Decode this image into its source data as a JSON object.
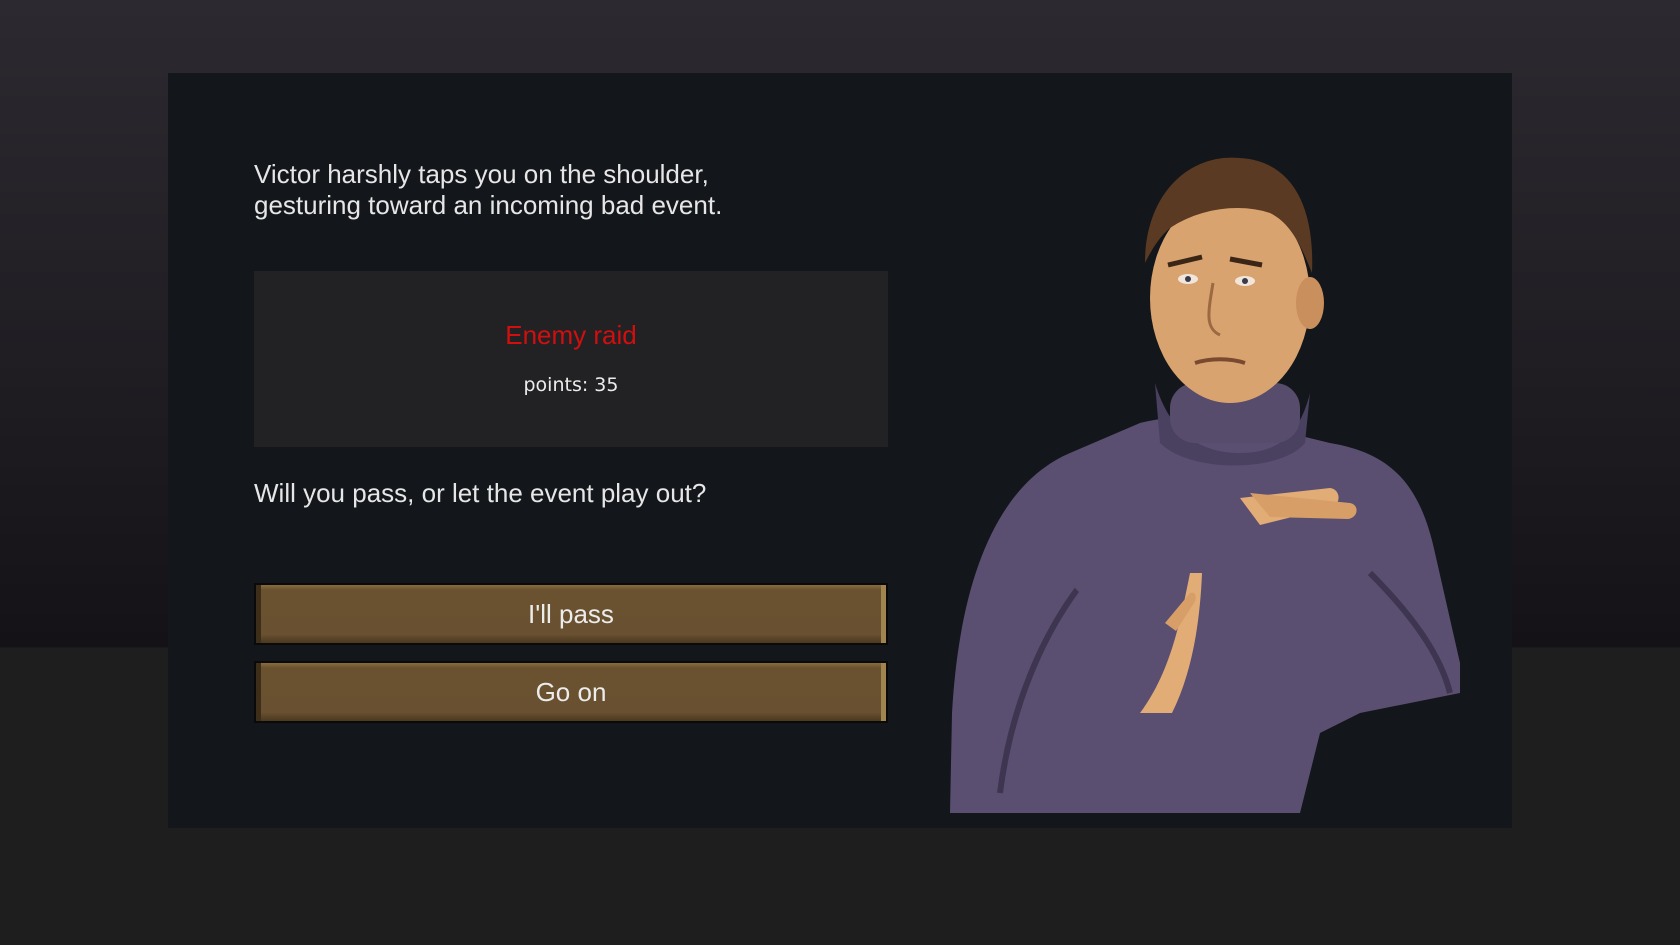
{
  "dialog": {
    "intro_lines": [
      "Victor harshly taps you on the shoulder,",
      "gesturing toward an incoming bad event."
    ],
    "event": {
      "title": "Enemy raid",
      "points": "points: 35",
      "title_color": "#d10f0f"
    },
    "question": "Will you pass, or let the event play out?",
    "buttons": {
      "pass_label": "I'll pass",
      "go_label": "Go on"
    },
    "portrait": {
      "icon": "storyteller-portrait",
      "character": "Victor"
    }
  }
}
